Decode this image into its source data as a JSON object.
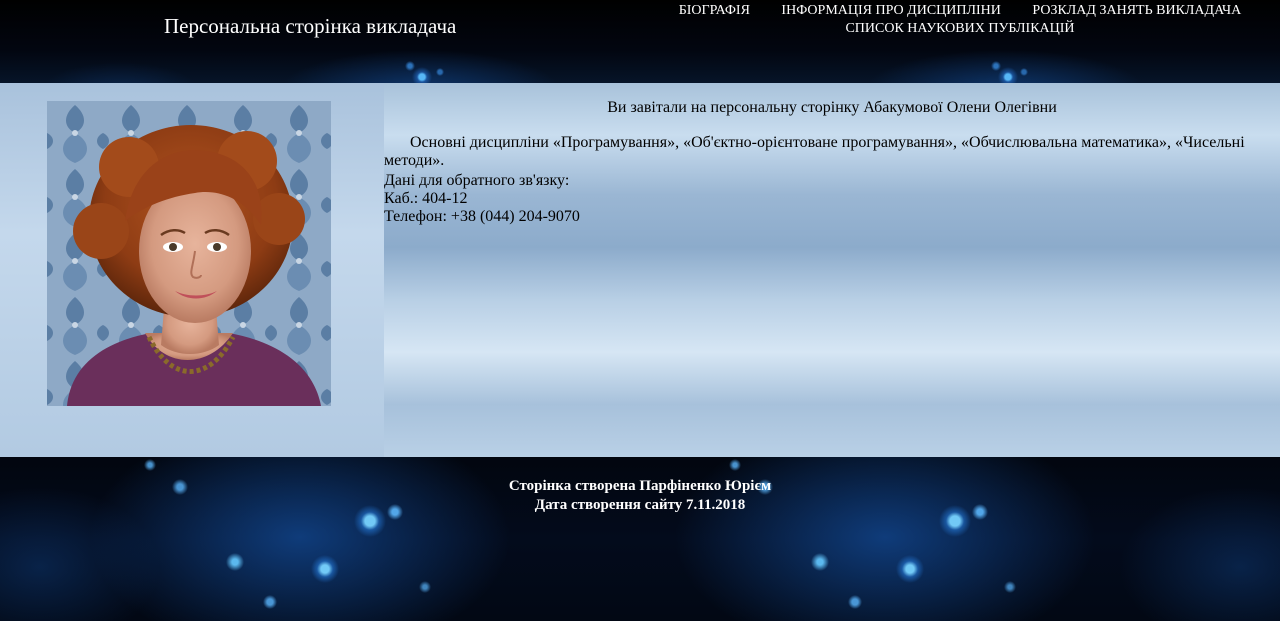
{
  "header": {
    "title": "Персональна сторінка викладача",
    "nav": {
      "items": [
        "БІОГРАФІЯ",
        "ІНФОРМАЦІЯ ПРО ДИСЦИПЛІНИ",
        "РОЗКЛАД ЗАНЯТЬ ВИКЛАДАЧА",
        "СПИСОК НАУКОВИХ ПУБЛІКАЦІЙ"
      ]
    }
  },
  "main": {
    "welcome": "Ви завітали на персональну сторінку Абакумової Олени Олегівни",
    "disciplines": "Основні дисципліни «Програмування», «Об'єктно-орієнтоване програмування», «Обчислювальна математика», «Чисельні методи».",
    "contact": {
      "heading": "Дані для обратного зв'язку:",
      "office": "Каб.: 404-12",
      "phone": "Телефон: +38 (044) 204-9070"
    }
  },
  "footer": {
    "credit": "Сторінка створена Парфіненко Юрієм",
    "date": "Дата створення сайту 7.11.2018"
  },
  "colors": {
    "header_bg": "#000000",
    "content_bg": "#a8c2da",
    "text_light": "#ffffff",
    "text_dark": "#000000"
  }
}
